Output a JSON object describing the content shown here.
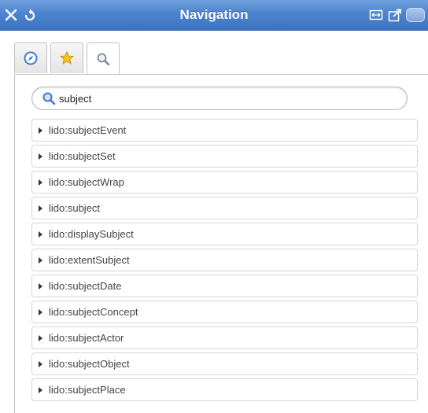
{
  "window": {
    "title": "Navigation",
    "accent": "#4d84cf",
    "left_buttons": [
      {
        "icon": "close-icon"
      },
      {
        "icon": "refresh-icon"
      }
    ],
    "right_buttons": [
      {
        "icon": "resize-icon"
      },
      {
        "icon": "external-link-icon"
      },
      {
        "icon": "toggle-icon"
      }
    ]
  },
  "tabs": [
    {
      "icon": "compass-icon",
      "active": false
    },
    {
      "icon": "star-icon",
      "active": false
    },
    {
      "icon": "search-icon",
      "active": true
    }
  ],
  "search": {
    "value": "subject",
    "icon": "search-icon"
  },
  "results": [
    {
      "label": "lido:subjectEvent"
    },
    {
      "label": "lido:subjectSet"
    },
    {
      "label": "lido:subjectWrap"
    },
    {
      "label": "lido:subject"
    },
    {
      "label": "lido:displaySubject"
    },
    {
      "label": "lido:extentSubject"
    },
    {
      "label": "lido:subjectDate"
    },
    {
      "label": "lido:subjectConcept"
    },
    {
      "label": "lido:subjectActor"
    },
    {
      "label": "lido:subjectObject"
    },
    {
      "label": "lido:subjectPlace"
    }
  ]
}
